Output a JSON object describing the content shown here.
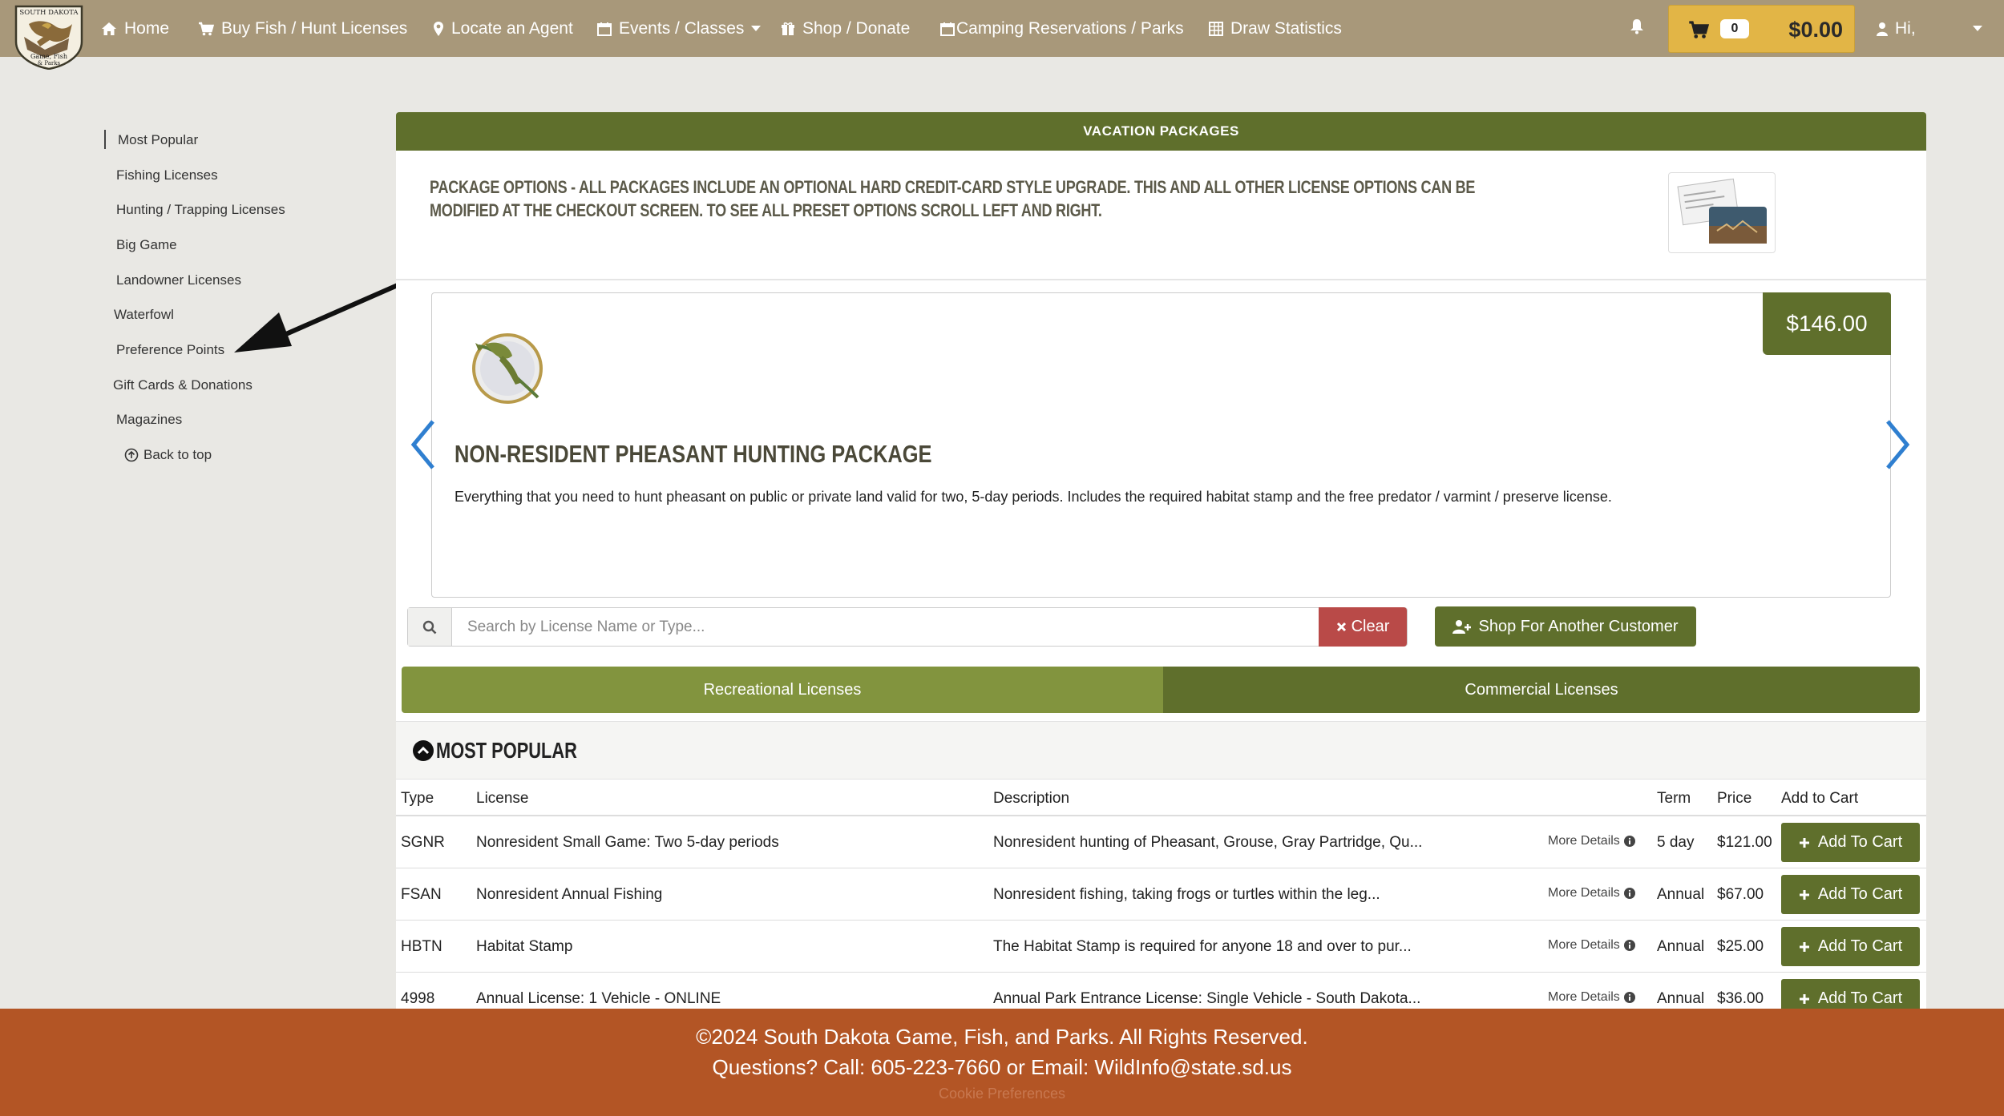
{
  "nav": {
    "home": "Home",
    "buy": "Buy Fish / Hunt Licenses",
    "locate": "Locate an Agent",
    "events": "Events / Classes",
    "shop": "Shop / Donate",
    "camping": "Camping Reservations / Parks",
    "draw": "Draw Statistics",
    "cart_count": "0",
    "cart_total": "$0.00",
    "user": "Hi,",
    "logo_text": [
      "SOUTH DAKOTA",
      "Game, Fish",
      "& Parks"
    ]
  },
  "sidebar": {
    "items": [
      {
        "label": "Most Popular"
      },
      {
        "label": "Fishing Licenses"
      },
      {
        "label": "Hunting / Trapping Licenses"
      },
      {
        "label": "Big Game"
      },
      {
        "label": "Landowner Licenses"
      },
      {
        "label": "Waterfowl"
      },
      {
        "label": "Preference Points"
      },
      {
        "label": "Gift Cards & Donations"
      },
      {
        "label": "Magazines"
      }
    ],
    "back_to_top": "Back to top"
  },
  "panel": {
    "title": "VACATION PACKAGES",
    "options_text": "Package Options - All packages include an optional hard credit-card style upgrade. This and all other license options can be modified at the checkout screen. To see all preset options scroll left and right."
  },
  "package": {
    "price": "$146.00",
    "title": "Non-Resident Pheasant Hunting Package",
    "description": "Everything that you need to hunt pheasant on public or private land valid for two, 5-day periods.  Includes the required habitat stamp and the free predator / varmint / preserve license."
  },
  "search": {
    "placeholder": "Search by License Name or Type...",
    "value": "",
    "clear_label": "Clear",
    "shop_other_label": "Shop For Another Customer"
  },
  "tabs": {
    "recreational": "Recreational Licenses",
    "commercial": "Commercial Licenses"
  },
  "section": {
    "title": "Most Popular"
  },
  "table": {
    "headers": {
      "type": "Type",
      "license": "License",
      "description": "Description",
      "term": "Term",
      "price": "Price",
      "add": "Add to Cart"
    },
    "more_details": "More Details",
    "add_label": "Add To Cart",
    "rows": [
      {
        "type": "SGNR",
        "license": "Nonresident Small Game: Two 5-day periods",
        "description": "Nonresident hunting of  Pheasant, Grouse, Gray Partridge, Qu...",
        "term": "5 day",
        "price": "$121.00"
      },
      {
        "type": "FSAN",
        "license": "Nonresident Annual Fishing",
        "description": "Nonresident fishing, taking frogs or turtles within the leg...",
        "term": "Annual",
        "price": "$67.00"
      },
      {
        "type": "HBTN",
        "license": "Habitat Stamp",
        "description": "The  Habitat Stamp is required for anyone 18 and over to pur...",
        "term": "Annual",
        "price": "$25.00"
      },
      {
        "type": "4998",
        "license": "Annual License: 1 Vehicle - ONLINE",
        "description": "Annual  Park Entrance  License: Single Vehicle - South Dakota...",
        "term": "Annual",
        "price": "$36.00"
      }
    ]
  },
  "footer": {
    "copyright": "©2024 South Dakota Game, Fish, and Parks. All Rights Reserved.",
    "contact": "Questions? Call: 605-223-7660 or Email: WildInfo@state.sd.us",
    "cookie": "Cookie Preferences"
  },
  "colors": {
    "nav_bg": "#a8987a",
    "accent_green": "#5f6f2c",
    "light_green": "#82943e",
    "cart_gold": "#e2b546",
    "footer_bg": "#b35525",
    "clear_red": "#b94a48"
  }
}
